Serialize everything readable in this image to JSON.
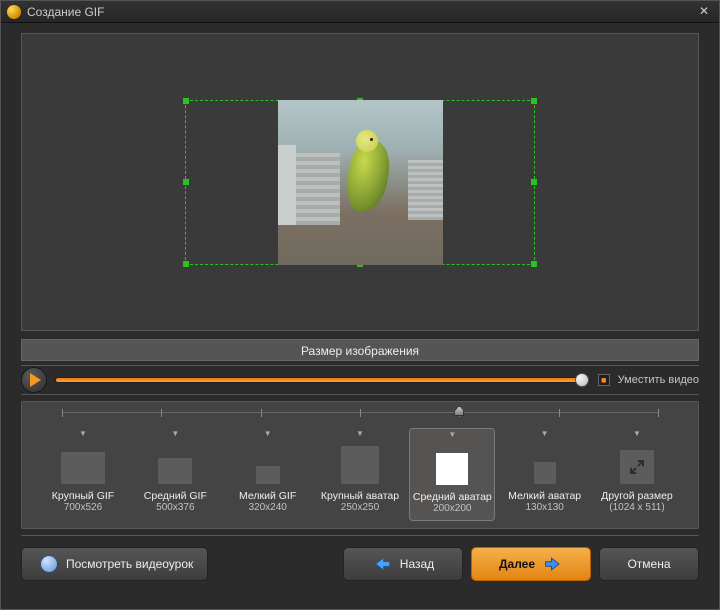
{
  "window": {
    "title": "Создание GIF"
  },
  "section": {
    "image_size": "Размер изображения"
  },
  "slider": {
    "fit_label": "Уместить видео",
    "fit_checked": true
  },
  "presets": {
    "selected_index": 4,
    "items": [
      {
        "label": "Крупный GIF",
        "dims": "700x526",
        "w": 44,
        "h": 32
      },
      {
        "label": "Средний GIF",
        "dims": "500x376",
        "w": 34,
        "h": 26
      },
      {
        "label": "Мелкий GIF",
        "dims": "320x240",
        "w": 24,
        "h": 18
      },
      {
        "label": "Крупный аватар",
        "dims": "250x250",
        "w": 38,
        "h": 38
      },
      {
        "label": "Средний аватар",
        "dims": "200x200",
        "w": 32,
        "h": 32
      },
      {
        "label": "Мелкий аватар",
        "dims": "130x130",
        "w": 22,
        "h": 22
      },
      {
        "label": "Другой размер",
        "dims": "(1024 x 511)",
        "w": 34,
        "h": 34,
        "other": true
      }
    ]
  },
  "footer": {
    "tutorial": "Посмотреть видеоурок",
    "back": "Назад",
    "next": "Далее",
    "cancel": "Отмена"
  }
}
